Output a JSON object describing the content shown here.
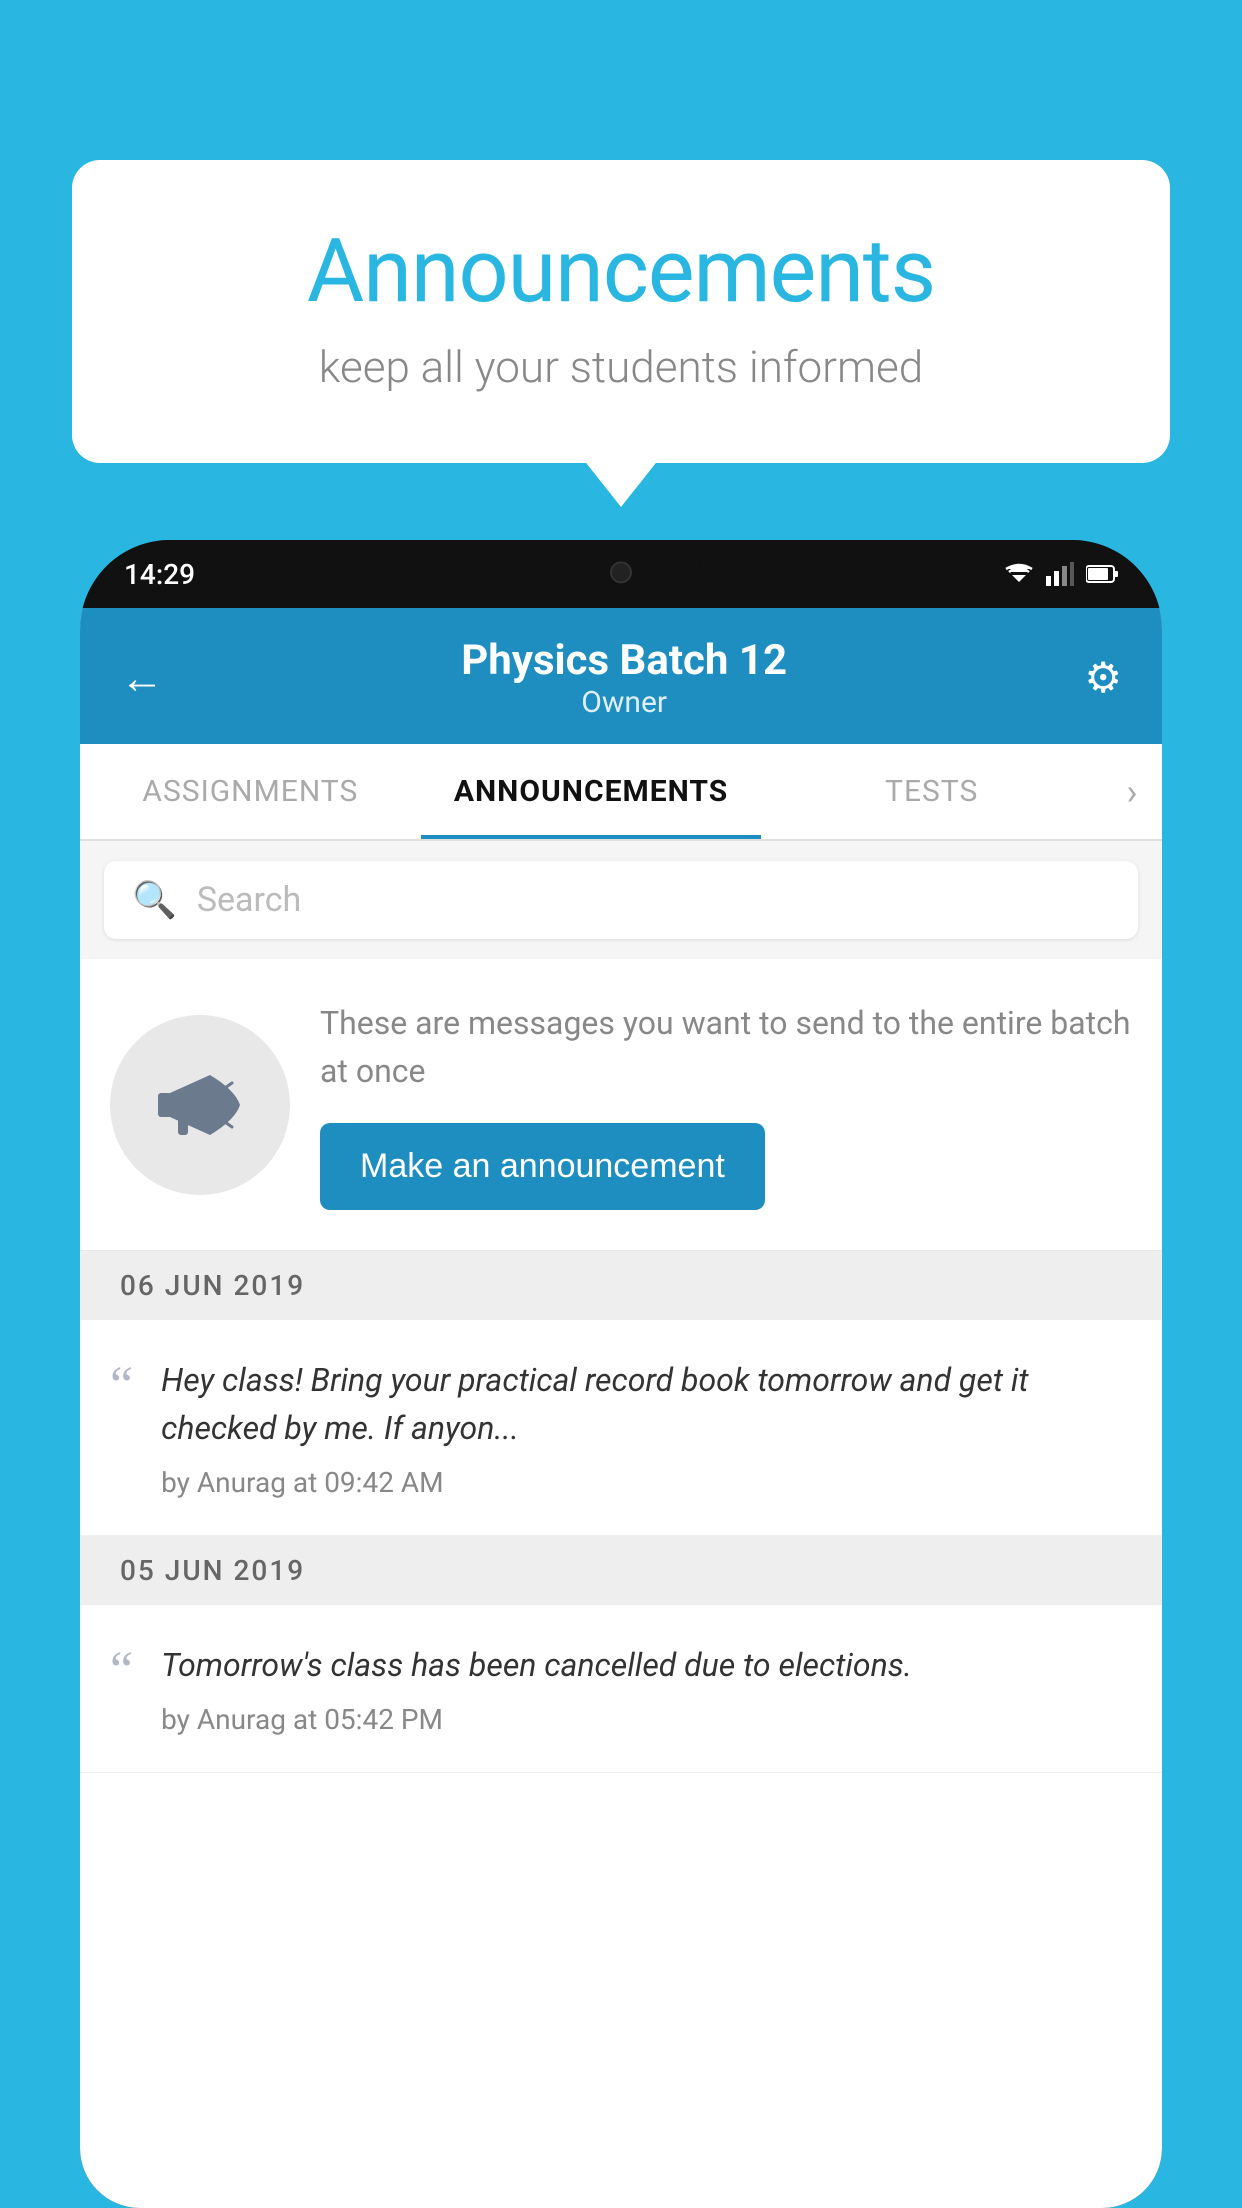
{
  "background_color": "#29b6e0",
  "speech_bubble": {
    "title": "Announcements",
    "subtitle": "keep all your students informed"
  },
  "phone": {
    "status_bar": {
      "time": "14:29",
      "icons": [
        "wifi",
        "signal",
        "battery"
      ]
    },
    "header": {
      "title": "Physics Batch 12",
      "subtitle": "Owner",
      "back_label": "←"
    },
    "tabs": [
      {
        "label": "ASSIGNMENTS",
        "active": false
      },
      {
        "label": "ANNOUNCEMENTS",
        "active": true
      },
      {
        "label": "TESTS",
        "active": false
      }
    ],
    "search": {
      "placeholder": "Search"
    },
    "promo": {
      "description": "These are messages you want to send to the entire batch at once",
      "button_label": "Make an announcement"
    },
    "announcements": [
      {
        "date": "06  JUN  2019",
        "text": "Hey class! Bring your practical record book tomorrow and get it checked by me. If anyon...",
        "meta": "by Anurag at 09:42 AM"
      },
      {
        "date": "05  JUN  2019",
        "text": "Tomorrow's class has been cancelled due to elections.",
        "meta": "by Anurag at 05:42 PM"
      }
    ]
  }
}
